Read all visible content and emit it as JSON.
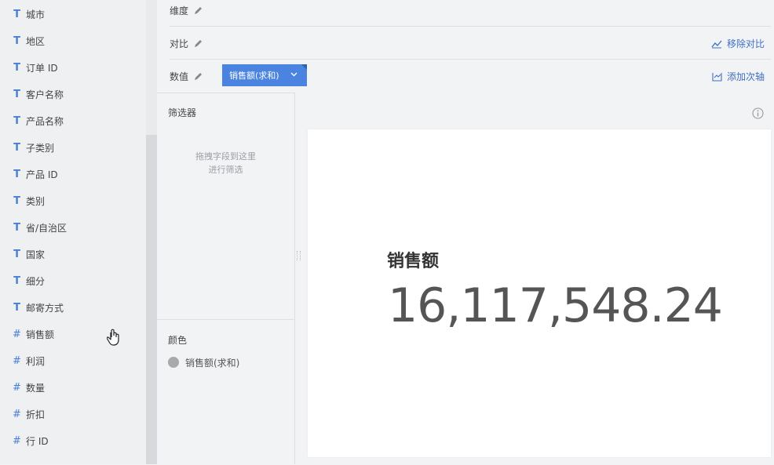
{
  "fields": [
    {
      "type": "T",
      "label": "城市"
    },
    {
      "type": "T",
      "label": "地区"
    },
    {
      "type": "T",
      "label": "订单 ID"
    },
    {
      "type": "T",
      "label": "客户名称"
    },
    {
      "type": "T",
      "label": "产品名称"
    },
    {
      "type": "T",
      "label": "子类别"
    },
    {
      "type": "T",
      "label": "产品 ID"
    },
    {
      "type": "T",
      "label": "类别"
    },
    {
      "type": "T",
      "label": "省/自治区"
    },
    {
      "type": "T",
      "label": "国家"
    },
    {
      "type": "T",
      "label": "细分"
    },
    {
      "type": "T",
      "label": "邮寄方式"
    },
    {
      "type": "#",
      "label": "销售额"
    },
    {
      "type": "#",
      "label": "利润"
    },
    {
      "type": "#",
      "label": "数量"
    },
    {
      "type": "#",
      "label": "折扣"
    },
    {
      "type": "#",
      "label": "行 ID"
    }
  ],
  "shelves": {
    "dimension_label": "维度",
    "compare_label": "对比",
    "value_label": "数值",
    "remove_compare": "移除对比",
    "add_secondary_axis": "添加次轴",
    "value_pill": "销售额(求和)"
  },
  "filter": {
    "title": "筛选器",
    "hint_line1": "拖拽字段到这里",
    "hint_line2": "进行筛选"
  },
  "color": {
    "title": "颜色",
    "legend_label": "销售额(求和)",
    "legend_color": "#a9a9a9"
  },
  "kpi": {
    "label": "销售额",
    "value": "16,117,548.24"
  },
  "accent": "#4a84e0"
}
